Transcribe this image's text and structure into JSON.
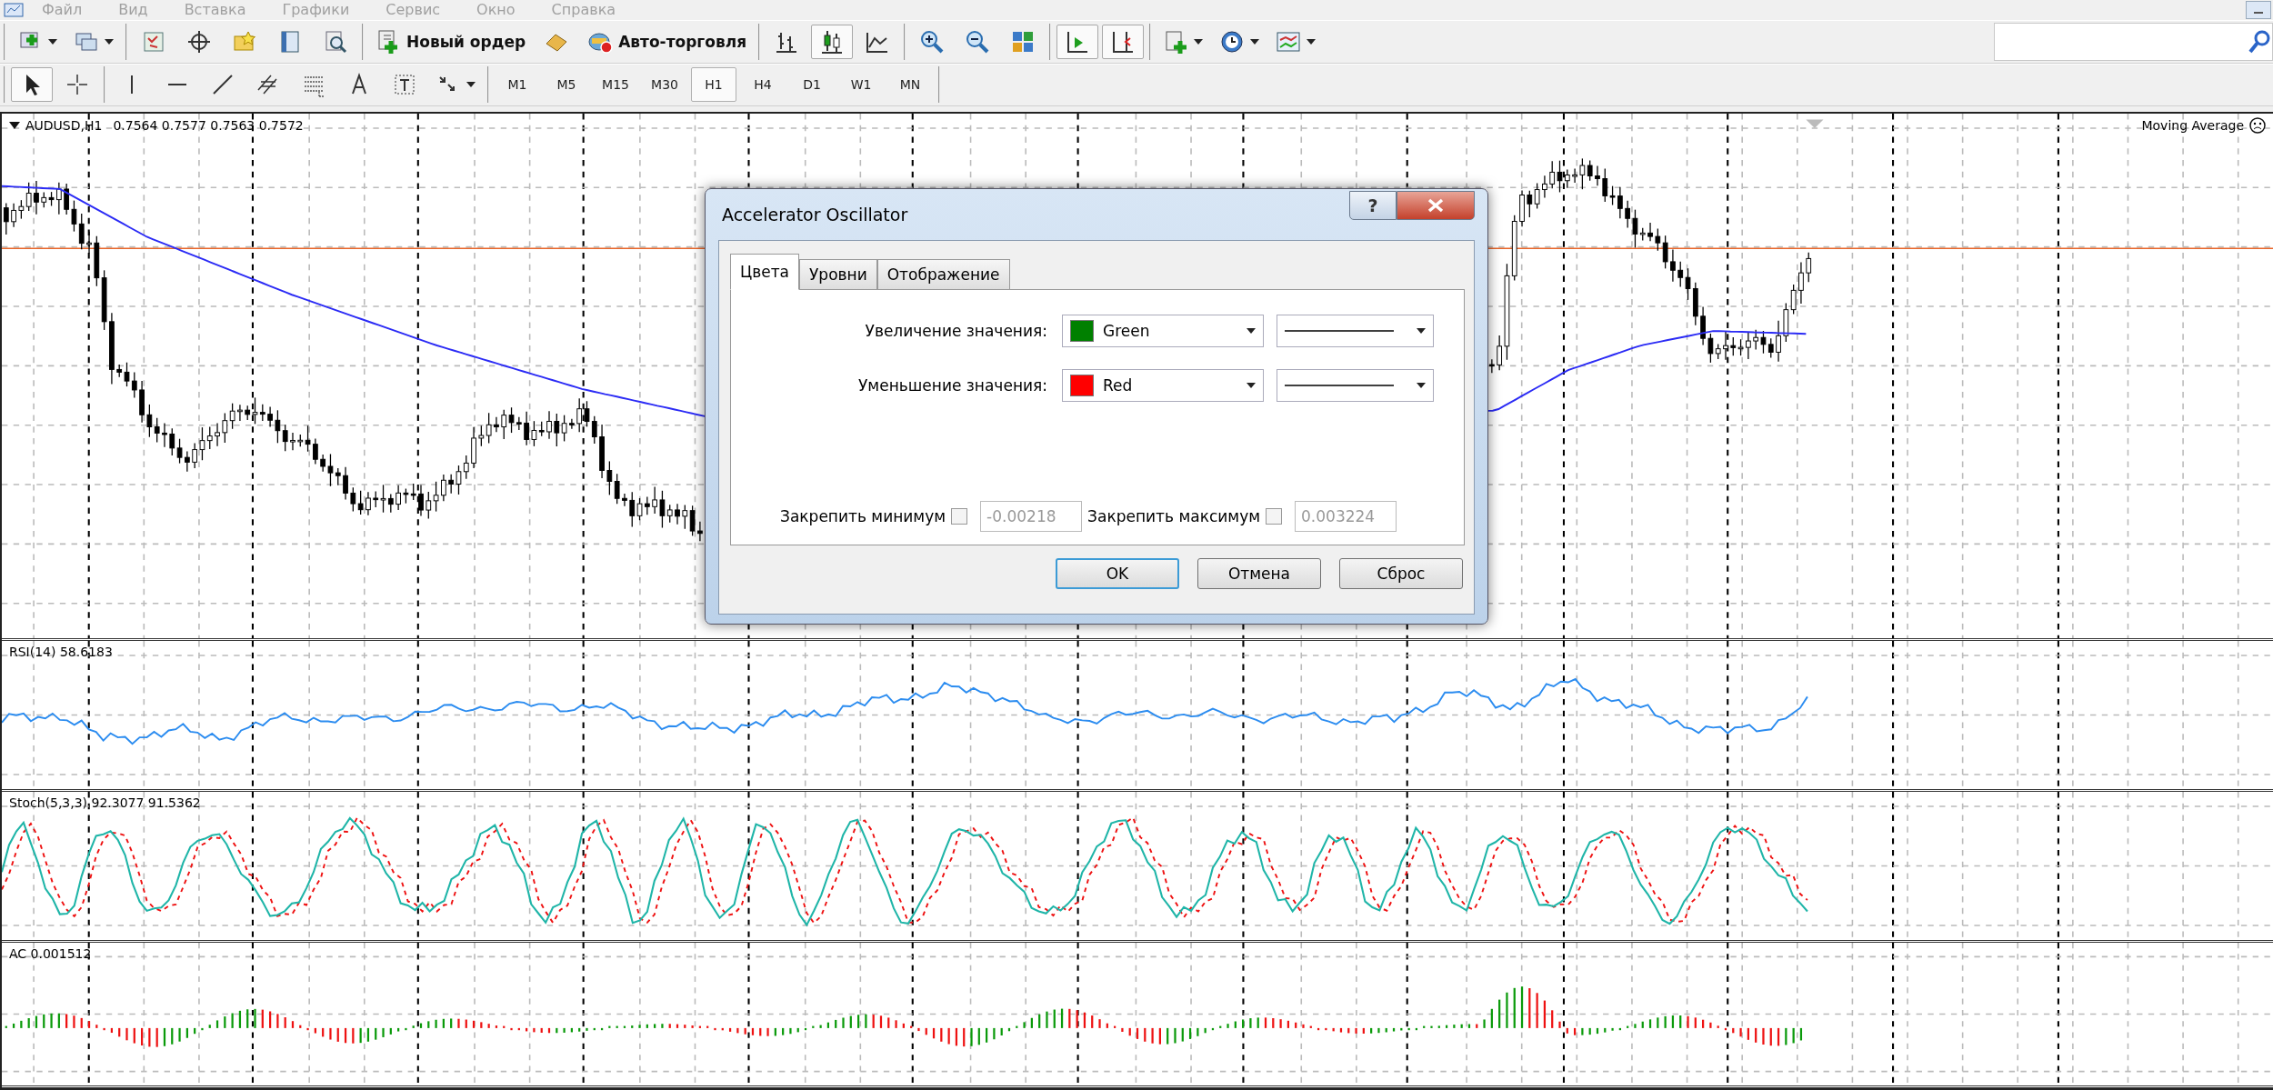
{
  "menu": [
    "Файл",
    "Вид",
    "Вставка",
    "Графики",
    "Сервис",
    "Окно",
    "Справка"
  ],
  "toolbar_1": [
    [
      {
        "kind": "newchart",
        "dropdown": true,
        "selected": false
      },
      {
        "kind": "profiles",
        "dropdown": true,
        "selected": false
      }
    ],
    [
      {
        "kind": "market",
        "dropdown": false,
        "selected": false
      },
      {
        "kind": "navigator",
        "dropdown": false,
        "selected": false
      },
      {
        "kind": "favorites",
        "dropdown": false,
        "selected": false
      },
      {
        "kind": "datawindow",
        "dropdown": false,
        "selected": false
      },
      {
        "kind": "tester",
        "dropdown": false,
        "selected": false
      }
    ],
    [
      {
        "kind": "order",
        "label": "Новый ордер",
        "dropdown": false,
        "selected": false
      },
      {
        "kind": "editor",
        "dropdown": false,
        "selected": false
      },
      {
        "kind": "autotrade",
        "label": "Авто-торговля",
        "dropdown": false,
        "selected": false
      }
    ],
    [
      {
        "kind": "bars",
        "dropdown": false,
        "selected": false
      },
      {
        "kind": "candles",
        "dropdown": false,
        "selected": true
      },
      {
        "kind": "line",
        "dropdown": false,
        "selected": false
      }
    ],
    [
      {
        "kind": "zoomin",
        "dropdown": false,
        "selected": false
      },
      {
        "kind": "zoomout",
        "dropdown": false,
        "selected": false
      },
      {
        "kind": "tile",
        "dropdown": false,
        "selected": false
      }
    ],
    [
      {
        "kind": "autoscroll",
        "dropdown": false,
        "selected": true
      },
      {
        "kind": "shift",
        "dropdown": false,
        "selected": true
      }
    ],
    [
      {
        "kind": "indicators",
        "dropdown": true,
        "selected": false
      },
      {
        "kind": "periods",
        "dropdown": true,
        "selected": false
      },
      {
        "kind": "templates",
        "dropdown": true,
        "selected": false
      }
    ]
  ],
  "toolbar_2": {
    "tools": [
      [
        {
          "kind": "cursor",
          "selected": true
        },
        {
          "kind": "crosshair",
          "selected": false
        }
      ],
      [
        {
          "kind": "vline",
          "selected": false
        },
        {
          "kind": "hline",
          "selected": false
        },
        {
          "kind": "trend",
          "selected": false
        },
        {
          "kind": "channel",
          "selected": false
        },
        {
          "kind": "fibo",
          "selected": false
        },
        {
          "kind": "text",
          "selected": false
        },
        {
          "kind": "label",
          "selected": false
        },
        {
          "kind": "arrows",
          "selected": false
        }
      ]
    ],
    "timeframes": [
      {
        "label": "M1",
        "selected": false
      },
      {
        "label": "M5",
        "selected": false
      },
      {
        "label": "M15",
        "selected": false
      },
      {
        "label": "M30",
        "selected": false
      },
      {
        "label": "H1",
        "selected": true
      },
      {
        "label": "H4",
        "selected": false
      },
      {
        "label": "D1",
        "selected": false
      },
      {
        "label": "W1",
        "selected": false
      },
      {
        "label": "MN",
        "selected": false
      }
    ]
  },
  "main_chart": {
    "symbol": "AUDUSD,H1",
    "prices": "0.7564 0.7577 0.7563 0.7572",
    "indicator": "Moving Average"
  },
  "subwindows": [
    {
      "kind": "rsi",
      "label": "RSI(14) 58.6183"
    },
    {
      "kind": "stoch",
      "label": "Stoch(5,3,3) 92.3077 91.5362"
    },
    {
      "kind": "ac",
      "label": "AC 0.001512"
    }
  ],
  "dialog": {
    "title": "Accelerator Oscillator",
    "help": "?",
    "tabs": [
      {
        "label": "Цвета",
        "selected": true
      },
      {
        "label": "Уровни",
        "selected": false
      },
      {
        "label": "Отображение",
        "selected": false
      }
    ],
    "colors": [
      {
        "label": "Увеличение значения:",
        "value": "Green",
        "color": "#008000"
      },
      {
        "label": "Уменьшение значения:",
        "value": "Red",
        "color": "#ff0000"
      }
    ],
    "limits": [
      {
        "label": "Закрепить минимум",
        "checked": false,
        "value": "-0.00218"
      },
      {
        "label": "Закрепить максимум",
        "checked": false,
        "value": "0.003224"
      }
    ],
    "buttons": [
      {
        "label": "OK",
        "default": true
      },
      {
        "label": "Отмена",
        "default": false
      },
      {
        "label": "Сброс",
        "default": false
      }
    ]
  }
}
